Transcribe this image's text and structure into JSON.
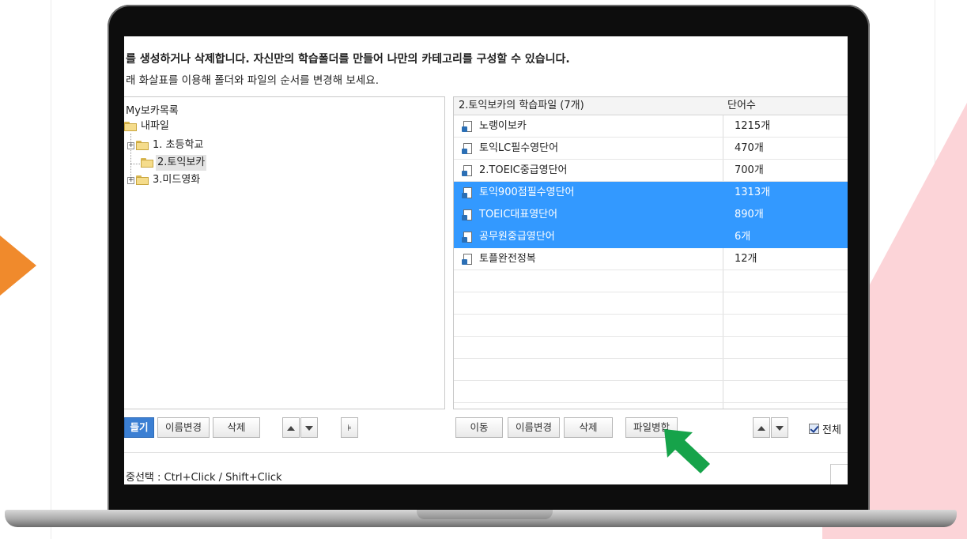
{
  "description": {
    "line1": "를 생성하거나 삭제합니다. 자신만의 학습폴더를 만들어 나만의 카테고리를 구성할 수 있습니다.",
    "line2": "래 화살표를 이용해 폴더와 파일의 순서를 변경해 보세요."
  },
  "tree": {
    "root": "My보카목록",
    "my_files": "내파일",
    "nodes": [
      {
        "label": "1. 초등학교",
        "expand": "+"
      },
      {
        "label": "2.토익보카",
        "expand": ""
      },
      {
        "label": "3.미드영화",
        "expand": "+"
      }
    ]
  },
  "files": {
    "header_name": "2.토익보카의 학습파일 (7개)",
    "header_count": "단어수",
    "rows": [
      {
        "name": "노랭이보카",
        "count": "1215개",
        "selected": false
      },
      {
        "name": "토익LC필수영단어",
        "count": "470개",
        "selected": false
      },
      {
        "name": "2.TOEIC중급영단어",
        "count": "700개",
        "selected": false
      },
      {
        "name": "토익900점필수영단어",
        "count": "1313개",
        "selected": true
      },
      {
        "name": "TOEIC대표영단어",
        "count": "890개",
        "selected": true
      },
      {
        "name": "공무원중급영단어",
        "count": "6개",
        "selected": true
      },
      {
        "name": "토플완전정복",
        "count": "12개",
        "selected": false
      }
    ]
  },
  "left_toolbar": {
    "make": "들기",
    "rename": "이름변경",
    "delete": "삭제"
  },
  "right_toolbar": {
    "move": "이동",
    "rename": "이름변경",
    "delete": "삭제",
    "merge": "파일병합",
    "select_all": "전체"
  },
  "status": {
    "hint": "중선택 : Ctrl+Click / Shift+Click"
  },
  "colors": {
    "selection": "#3399ff",
    "accent_arrow": "#f08a2c",
    "pointer_arrow": "#16a34a",
    "primary_button": "#3b7fd3"
  },
  "icons": [
    "folder-icon",
    "document-icon",
    "arrow-up-icon",
    "arrow-down-icon",
    "tree-view-icon",
    "green-pointer-arrow-icon",
    "orange-arrow-icon"
  ]
}
